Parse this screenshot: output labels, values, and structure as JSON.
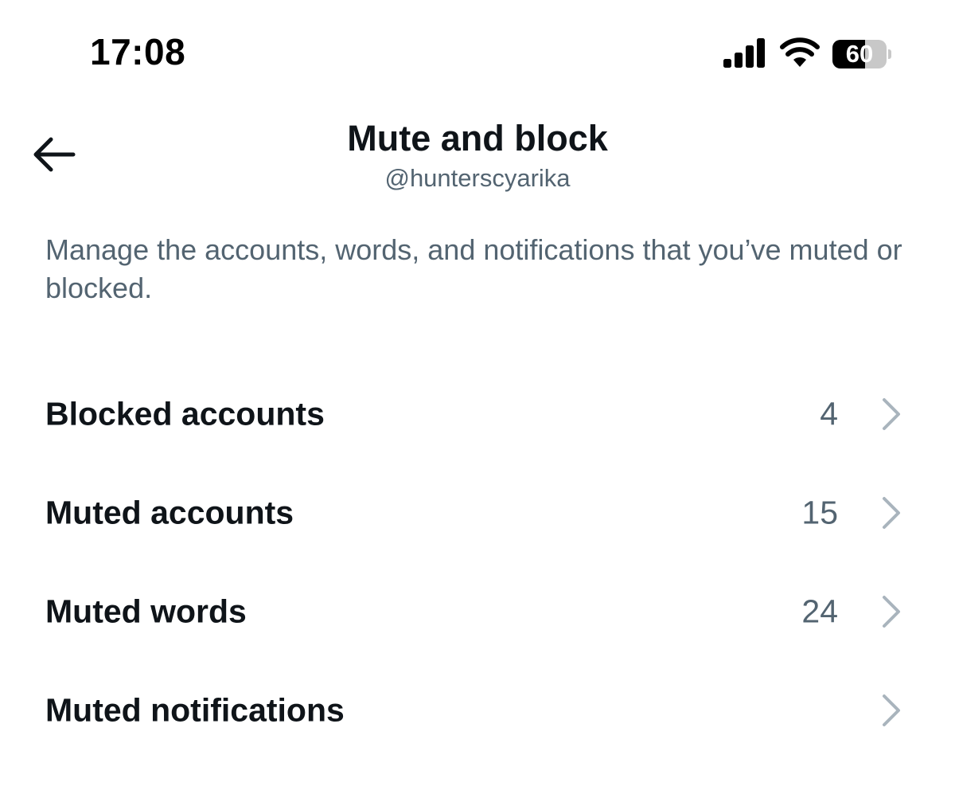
{
  "status_bar": {
    "time": "17:08",
    "battery_level": "60",
    "battery_fraction": 0.6
  },
  "header": {
    "title": "Mute and block",
    "subtitle": "@hunterscyarika",
    "back_icon": "arrow-left-icon"
  },
  "description": "Manage the accounts, words, and notifications that you’ve muted or blocked.",
  "menu": {
    "items": [
      {
        "label": "Blocked accounts",
        "count": "4"
      },
      {
        "label": "Muted accounts",
        "count": "15"
      },
      {
        "label": "Muted words",
        "count": "24"
      },
      {
        "label": "Muted notifications",
        "count": ""
      }
    ],
    "chevron_icon": "chevron-right-icon"
  },
  "colors": {
    "primary_text": "#0f1419",
    "secondary_text": "#536471",
    "chevron": "#a9b4bd",
    "background": "#ffffff"
  }
}
